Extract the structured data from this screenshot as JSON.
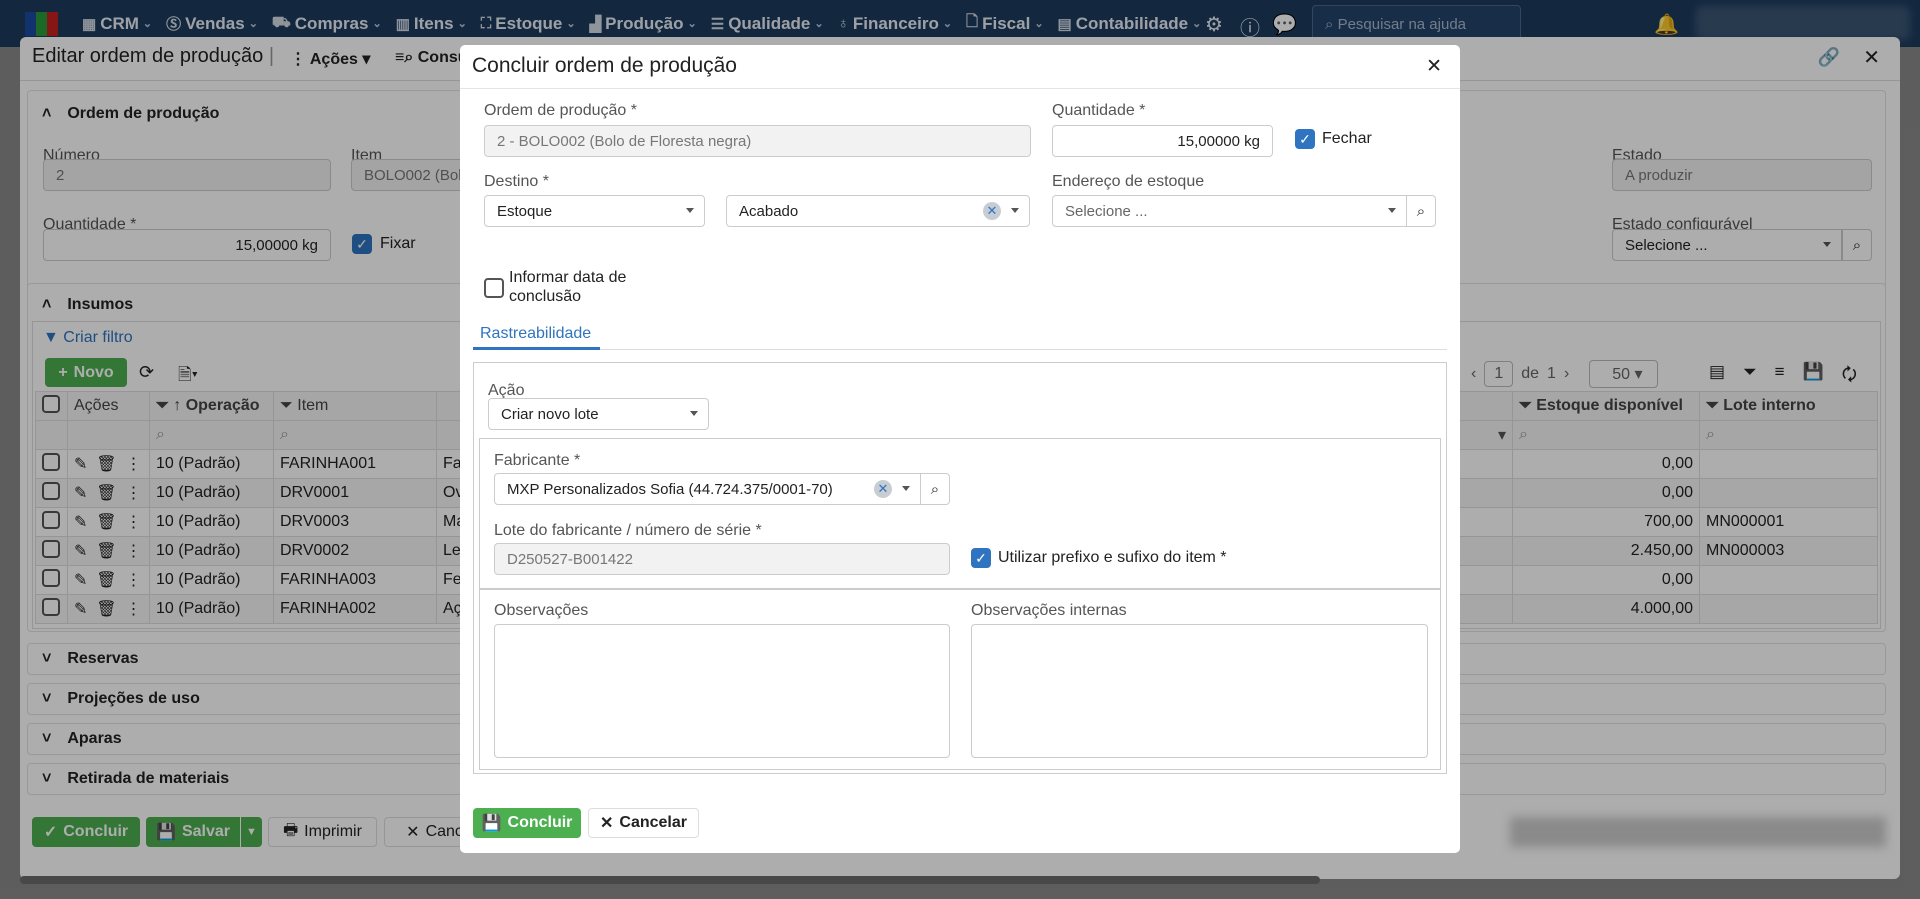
{
  "topbar": {
    "menu": [
      {
        "label": "CRM",
        "icon": "crm-icon"
      },
      {
        "label": "Vendas",
        "icon": "dollar-icon"
      },
      {
        "label": "Compras",
        "icon": "cart-icon"
      },
      {
        "label": "Itens",
        "icon": "items-icon"
      },
      {
        "label": "Estoque",
        "icon": "dolly-icon"
      },
      {
        "label": "Produção",
        "icon": "factory-icon"
      },
      {
        "label": "Qualidade",
        "icon": "checklist-icon"
      },
      {
        "label": "Financeiro",
        "icon": "money-bag-icon"
      },
      {
        "label": "Fiscal",
        "icon": "document-icon"
      },
      {
        "label": "Contabilidade",
        "icon": "calculator-icon"
      }
    ],
    "search_placeholder": "Pesquisar na ajuda"
  },
  "panel": {
    "title": "Editar ordem de produção",
    "actions": "Ações",
    "consult": "Consu",
    "section_order": "Ordem de produção",
    "numero_label": "Número",
    "numero": "2",
    "item_label": "Item",
    "item": "BOLO002 (Bolo",
    "estado_label": "Estado",
    "estado": "A produzir",
    "quantidade_label": "Quantidade *",
    "quantidade": "15,00000 kg",
    "fixar": "Fixar",
    "fixar_checked": true,
    "estado_conf_label": "Estado configurável",
    "estado_conf": "Selecione ...",
    "section_insumos": "Insumos",
    "criar_filtro": "Criar filtro",
    "novo": "Novo",
    "pagination": {
      "page": "1",
      "of": "de",
      "total": "1",
      "page_size": "50"
    },
    "columns": {
      "acoes": "Ações",
      "operacao": "Operação",
      "item": "Item",
      "estoque": "Estoque disponível",
      "lote": "Lote interno"
    },
    "rows": [
      {
        "op": "10 (Padrão)",
        "item": "FARINHA001",
        "desc": "Fa",
        "estoque": "0,00",
        "lote": ""
      },
      {
        "op": "10 (Padrão)",
        "item": "DRV0001",
        "desc": "Ov",
        "estoque": "0,00",
        "lote": ""
      },
      {
        "op": "10 (Padrão)",
        "item": "DRV0003",
        "desc": "Ma",
        "estoque": "700,00",
        "lote": "MN000001"
      },
      {
        "op": "10 (Padrão)",
        "item": "DRV0002",
        "desc": "Le",
        "estoque": "2.450,00",
        "lote": "MN000003"
      },
      {
        "op": "10 (Padrão)",
        "item": "FARINHA003",
        "desc": "Fe",
        "estoque": "0,00",
        "lote": ""
      },
      {
        "op": "10 (Padrão)",
        "item": "FARINHA002",
        "desc": "Aç",
        "estoque": "4.000,00",
        "lote": ""
      }
    ],
    "sections": [
      "Reservas",
      "Projeções de uso",
      "Aparas",
      "Retirada de materiais"
    ],
    "footer": {
      "concluir": "Concluir",
      "salvar": "Salvar",
      "imprimir": "Imprimir",
      "cancelar": "Cance"
    }
  },
  "modal": {
    "title": "Concluir ordem de produção",
    "ordem_label": "Ordem de produção *",
    "ordem": "2 - BOLO002 (Bolo de Floresta negra)",
    "quantidade_label": "Quantidade *",
    "quantidade": "15,00000 kg",
    "fechar": "Fechar",
    "fechar_checked": true,
    "destino_label": "Destino *",
    "destino_tipo": "Estoque",
    "destino": "Acabado",
    "endereco_label": "Endereço de estoque",
    "endereco": "Selecione ...",
    "informar_data": "Informar data de conclusão",
    "informar_checked": false,
    "tab": "Rastreabilidade",
    "acao_label": "Ação",
    "acao": "Criar novo lote",
    "fabricante_label": "Fabricante *",
    "fabricante": "MXP Personalizados Sofia (44.724.375/0001-70)",
    "lote_label": "Lote do fabricante / número de série *",
    "lote": "D250527-B001422",
    "utilizar": "Utilizar prefixo e sufixo do item *",
    "utilizar_checked": true,
    "obs_label": "Observações",
    "obs_int_label": "Observações internas",
    "concluir": "Concluir",
    "cancelar": "Cancelar"
  },
  "colors": {
    "topbar": "#1d3b5e",
    "accent": "#2f74c0",
    "success": "#4caf50"
  }
}
